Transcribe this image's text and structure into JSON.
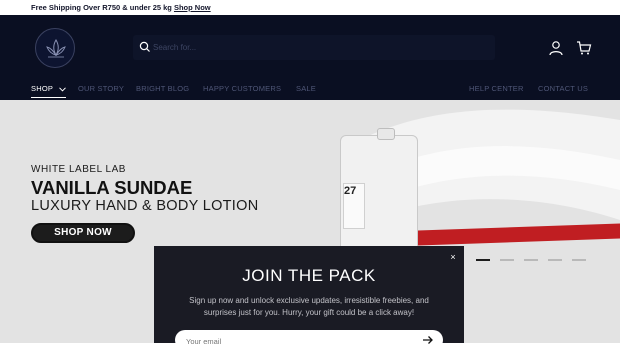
{
  "announcement": {
    "text": "Free Shipping Over R750 & under 25 kg ",
    "link": "Shop Now"
  },
  "search": {
    "placeholder": "Search for..."
  },
  "nav": {
    "items": [
      {
        "label": "SHOP",
        "active": true
      },
      {
        "label": "OUR STORY"
      },
      {
        "label": "BRIGHT BLOG"
      },
      {
        "label": "HAPPY CUSTOMERS"
      },
      {
        "label": "SALE"
      }
    ],
    "right": [
      {
        "label": "HELP CENTER"
      },
      {
        "label": "CONTACT US"
      }
    ]
  },
  "hero": {
    "brand": "WHITE LABEL LAB",
    "product": "VANILLA SUNDAE",
    "subtitle": "LUXURY HAND & BODY LOTION",
    "cta": "SHOP NOW",
    "jug_number": "27"
  },
  "slider": {
    "slides": 5,
    "active_index": 0
  },
  "popup": {
    "close": "×",
    "title": "JOIN THE PACK",
    "body": "Sign up now and unlock exclusive updates, irresistible freebies, and surprises just for you. Hurry, your gift could be a click away!",
    "email_placeholder": "Your email"
  },
  "colors": {
    "header_bg": "#0a0f22",
    "hero_bg": "#e3e3e3",
    "accent_red": "#c01e22",
    "popup_bg": "#1a1b24"
  }
}
